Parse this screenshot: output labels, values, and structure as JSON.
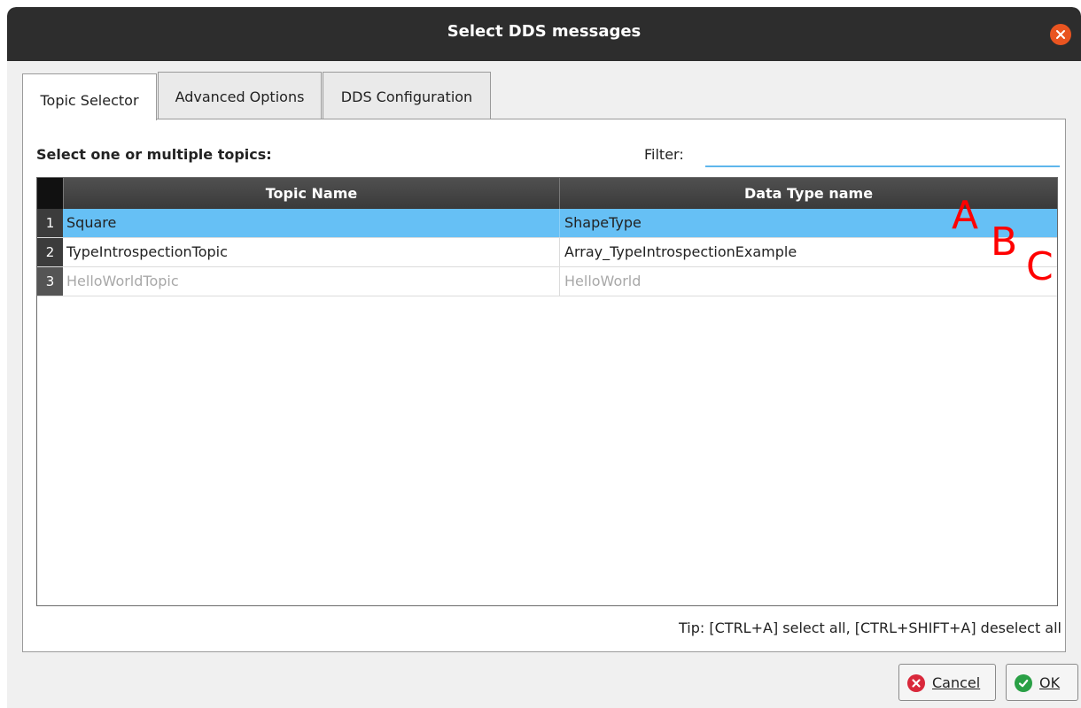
{
  "window": {
    "title": "Select DDS messages"
  },
  "tabs": [
    {
      "label": "Topic Selector",
      "active": true
    },
    {
      "label": "Advanced Options",
      "active": false
    },
    {
      "label": "DDS Configuration",
      "active": false
    }
  ],
  "panel": {
    "select_label": "Select one or multiple topics:",
    "filter_label": "Filter:",
    "filter_value": "",
    "table": {
      "headers": [
        "Topic Name",
        "Data Type name"
      ],
      "rows": [
        {
          "num": "1",
          "topic": "Square",
          "type": "ShapeType",
          "state": "selected"
        },
        {
          "num": "2",
          "topic": "TypeIntrospectionTopic",
          "type": "Array_TypeIntrospectionExample",
          "state": "normal"
        },
        {
          "num": "3",
          "topic": "HelloWorldTopic",
          "type": "HelloWorld",
          "state": "disabled"
        }
      ]
    },
    "tip": "Tip: [CTRL+A] select all, [CTRL+SHIFT+A] deselect all"
  },
  "annotations": [
    "A",
    "B",
    "C"
  ],
  "buttons": {
    "cancel": "Cancel",
    "ok": "OK"
  },
  "colors": {
    "titlebar": "#2d2d2d",
    "close": "#e95420",
    "selection": "#66c0f5",
    "filter_underline": "#5fb6ec",
    "annotation": "#ff0000",
    "cancel_icon": "#d9283b",
    "ok_icon": "#2aa046"
  }
}
